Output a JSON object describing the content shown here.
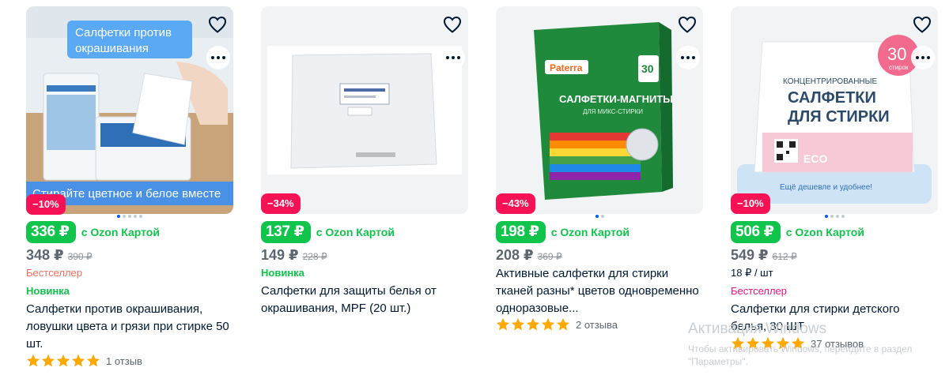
{
  "products": [
    {
      "discount": "−10%",
      "ozon_price": "336 ₽",
      "ozon_card_label": "с Ozon Картой",
      "current_price": "348 ₽",
      "old_price": "390 ₽",
      "badges": {
        "bestseller": "Бестселлер",
        "new": "Новинка"
      },
      "title": "Салфетки против окрашивания, ловушки цвета и грязи при стирке 50 шт.",
      "rating_text": "1 отзыв",
      "image": {
        "banner_top": "Салфетки против окрашивания",
        "banner_bottom": "Стирайте цветное и белое вместе"
      }
    },
    {
      "discount": "−34%",
      "ozon_price": "137 ₽",
      "ozon_card_label": "с Ozon Картой",
      "current_price": "149 ₽",
      "old_price": "228 ₽",
      "badges": {
        "new": "Новинка"
      },
      "title": "Салфетки для защиты белья от окрашивания, MPF (20 шт.)"
    },
    {
      "discount": "−43%",
      "ozon_price": "198 ₽",
      "ozon_card_label": "с Ozon Картой",
      "current_price": "208 ₽",
      "old_price": "369 ₽",
      "title": "Активные салфетки для стирки тканей разны* цветов одновременно одноразовые...",
      "rating_text": "2 отзыва",
      "image": {
        "brand": "Paterra",
        "label": "САЛФЕТКИ-МАГНИТЫ",
        "sublabel": "ДЛЯ МИКС-СТИРКИ",
        "count": "30"
      }
    },
    {
      "discount": "−10%",
      "ozon_price": "506 ₽",
      "ozon_card_label": "с Ozon Картой",
      "current_price": "549 ₽",
      "old_price": "612 ₽",
      "unit_price": "18 ₽ / шт",
      "badges": {
        "bestseller": "Бестселлер"
      },
      "title": "Салфетки для стирки детского белья, 30 ШТ",
      "rating_text": "37 отзывов",
      "image": {
        "line1": "КОНЦЕНТРИРОВАННЫЕ",
        "line2": "САЛФЕТКИ",
        "line3": "ДЛЯ СТИРКИ",
        "count": "30",
        "count_unit": "стирок",
        "eco": "ECO",
        "footer": "Ещё дешевле и удобнее!"
      }
    }
  ],
  "watermark": {
    "line1": "Активация Windows",
    "line2": "Чтобы активировать Windows, перейдите в раздел",
    "line3": "\"Параметры\"."
  },
  "colors": {
    "ozon_green": "#10c44c",
    "discount_red": "#f91155",
    "bestseller": "#f1117e",
    "star": "#ffa800",
    "accent": "#005bff"
  }
}
